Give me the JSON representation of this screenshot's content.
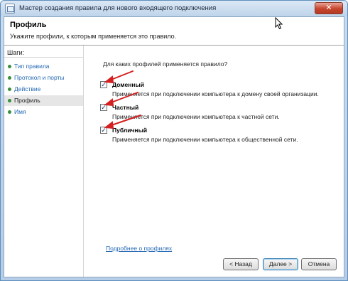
{
  "window": {
    "title": "Мастер создания правила для нового входящего подключения",
    "close_symbol": "✕"
  },
  "header": {
    "title": "Профиль",
    "subtitle": "Укажите профили, к которым применяется это правило."
  },
  "steps": {
    "heading": "Шаги:",
    "items": [
      {
        "label": "Тип правила",
        "current": false
      },
      {
        "label": "Протокол и порты",
        "current": false
      },
      {
        "label": "Действие",
        "current": false
      },
      {
        "label": "Профиль",
        "current": true
      },
      {
        "label": "Имя",
        "current": false
      }
    ]
  },
  "content": {
    "question": "Для каких профилей применяется правило?",
    "options": [
      {
        "label": "Доменный",
        "checked": true,
        "description": "Применяется при подключении компьютера к домену своей организации."
      },
      {
        "label": "Частный",
        "checked": true,
        "description": "Применяется при подключении компьютера к частной сети."
      },
      {
        "label": "Публичный",
        "checked": true,
        "description": "Применяется при подключении компьютера к общественной сети."
      }
    ],
    "link": "Подробнее о профилях"
  },
  "buttons": {
    "back": "< Назад",
    "next": "Далее >",
    "cancel": "Отмена"
  },
  "colors": {
    "annotation_arrow": "#d42020",
    "link": "#2469b3",
    "step_bullet": "#3a8f3a"
  }
}
